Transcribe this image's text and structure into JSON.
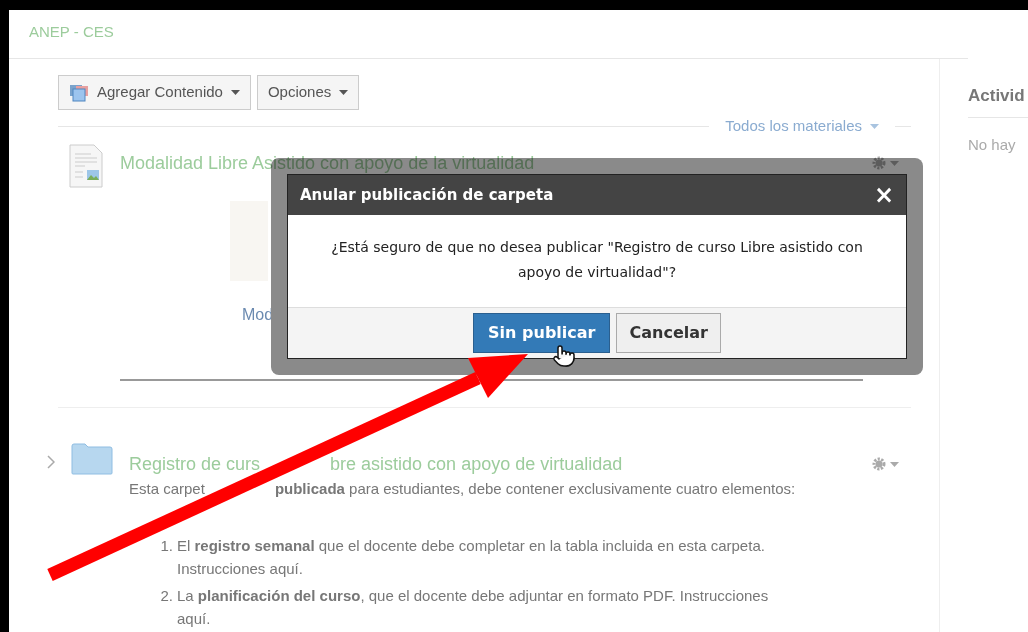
{
  "site_title": "ANEP - CES",
  "toolbar": [
    {
      "label": "Agregar Contenido",
      "kind": "add"
    },
    {
      "label": "Opciones",
      "kind": "plain"
    }
  ],
  "filter": {
    "label": "Todos los materiales"
  },
  "items": [
    {
      "kind": "document",
      "title": "Modalidad Libre Asistido con apoyo de la virtualidad",
      "link": "Mod"
    },
    {
      "kind": "folder",
      "title_parts": [
        "Registro de curs",
        "bre asistido con apoyo de virtualidad"
      ],
      "description_parts": [
        "Esta carpet",
        "**publicada** para estudiantes, debe contener exclusivamente cuatro elementos:"
      ],
      "list": [
        {
          "number": "1.",
          "text": "El **registro semanal** que el docente debe completar en la tabla incluida en esta carpeta. Instrucciones aquí."
        },
        {
          "number": "2.",
          "text": "La **planificación del curso**, que el docente debe adjuntar en formato PDF. Instrucciones aquí."
        }
      ]
    }
  ],
  "sidebar": {
    "heading": "Activid",
    "text": "No hay"
  },
  "dialog": {
    "title": "Anular publicación de carpeta",
    "close": "×",
    "message": "¿Está seguro de que no desea publicar \"Registro de curso Libre asistido con apoyo de virtualidad\"?",
    "buttons": [
      {
        "label": "Sin publicar",
        "kind": "primary"
      },
      {
        "label": "Cancelar",
        "kind": "secondary"
      }
    ]
  }
}
